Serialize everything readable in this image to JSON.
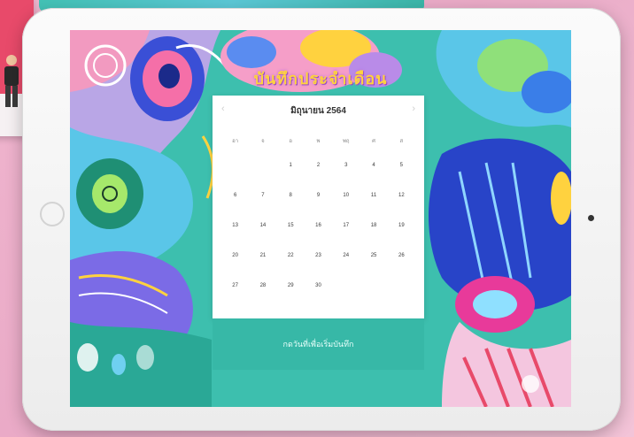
{
  "app": {
    "title": "บันทึกประจำเดือน"
  },
  "calendar": {
    "month_label": "มิถุนายน 2564",
    "prev_icon": "chevron-left-icon",
    "next_icon": "chevron-right-icon",
    "weekdays": [
      "อา",
      "จ",
      "อ",
      "พ",
      "พฤ",
      "ศ",
      "ส"
    ],
    "weeks": [
      [
        "",
        "",
        "1",
        "2",
        "3",
        "4",
        "5"
      ],
      [
        "6",
        "7",
        "8",
        "9",
        "10",
        "11",
        "12"
      ],
      [
        "13",
        "14",
        "15",
        "16",
        "17",
        "18",
        "19"
      ],
      [
        "20",
        "21",
        "22",
        "23",
        "24",
        "25",
        "26"
      ],
      [
        "27",
        "28",
        "29",
        "30",
        "",
        "",
        ""
      ]
    ]
  },
  "action": {
    "label": "กดวันที่เพื่อเริ่มบันทึก"
  },
  "colors": {
    "screen_bg": "#3dbfae",
    "title": "#ffd23f",
    "cta_bg": "#37b8a7",
    "page_bg": "#f0b6cf"
  }
}
